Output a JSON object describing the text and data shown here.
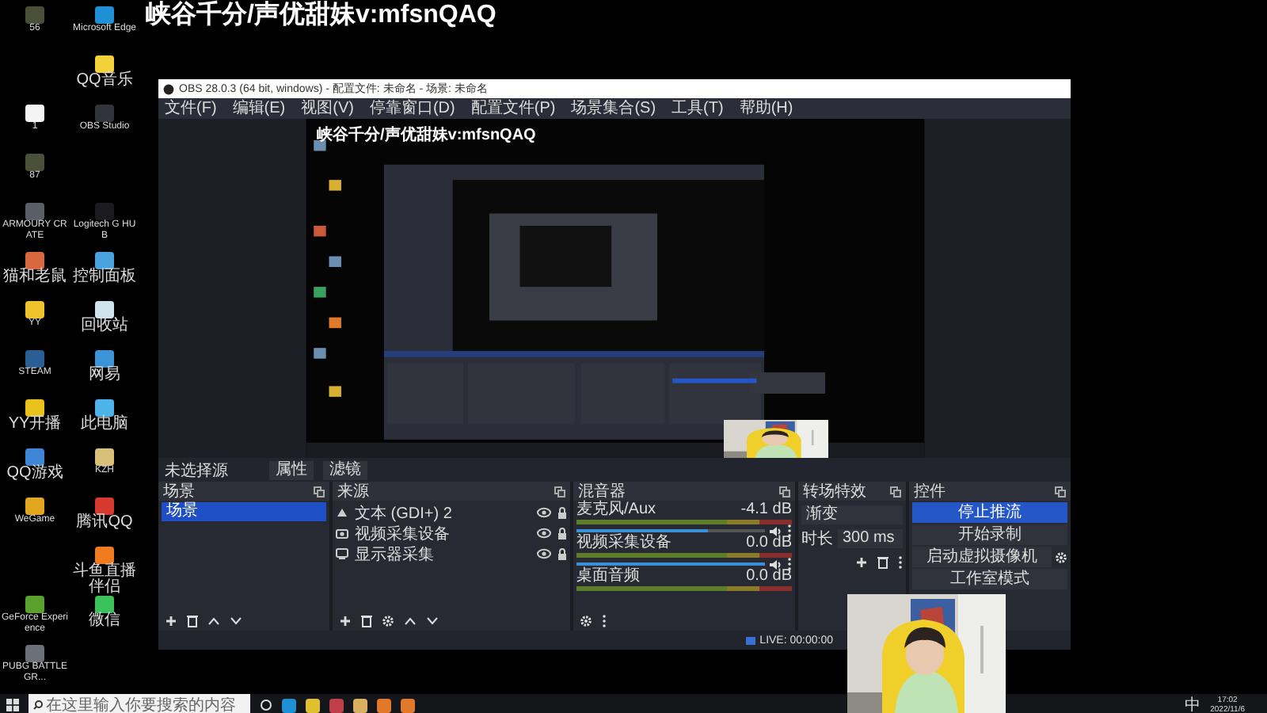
{
  "overlay_text": "峡谷千分/声优甜妹v:mfsnQAQ",
  "desktop_rows": [
    {
      "icons": [
        {
          "kind": "app",
          "label": "56",
          "color": "#4a4f3a"
        },
        {
          "kind": "app",
          "label": "Microsoft Edge",
          "color": "#1f8fd6"
        }
      ]
    },
    {
      "icons": [
        {
          "kind": "blank"
        },
        {
          "kind": "app",
          "label": "QQ音乐",
          "color": "#f2d13a"
        }
      ]
    },
    {
      "icons": [
        {
          "kind": "app",
          "label": "1",
          "color": "#f4f4f4"
        },
        {
          "kind": "app",
          "label": "OBS Studio",
          "color": "#30343a"
        }
      ]
    },
    {
      "icons": [
        {
          "kind": "app",
          "label": "87",
          "color": "#4a4f3a"
        },
        {
          "kind": "blank"
        }
      ]
    },
    {
      "icons": [
        {
          "kind": "app",
          "label": "ARMOURY CRATE",
          "color": "#5a5e66"
        },
        {
          "kind": "app",
          "label": "Logitech G HUB",
          "color": "#1b1b1f"
        }
      ]
    },
    {
      "icons": [
        {
          "kind": "app",
          "label": "猫和老鼠",
          "color": "#d9673f"
        },
        {
          "kind": "app",
          "label": "控制面板",
          "color": "#4aa3df"
        }
      ]
    },
    {
      "icons": [
        {
          "kind": "app",
          "label": "YY",
          "color": "#f0c22c"
        },
        {
          "kind": "app",
          "label": "回收站",
          "color": "#cfe3ef"
        }
      ]
    },
    {
      "icons": [
        {
          "kind": "app",
          "label": "STEAM",
          "color": "#2a5f95"
        },
        {
          "kind": "app",
          "label": "网易",
          "color": "#3c94d8"
        }
      ]
    },
    {
      "icons": [
        {
          "kind": "app",
          "label": "YY开播",
          "color": "#e9c21c"
        },
        {
          "kind": "app",
          "label": "此电脑",
          "color": "#4db3e8"
        }
      ]
    },
    {
      "icons": [
        {
          "kind": "app",
          "label": "QQ游戏",
          "color": "#3f86d6"
        },
        {
          "kind": "app",
          "label": "KZH",
          "color": "#d9c07a"
        }
      ]
    },
    {
      "icons": [
        {
          "kind": "app",
          "label": "WeGame",
          "color": "#e1a520"
        },
        {
          "kind": "app",
          "label": "腾讯QQ",
          "color": "#d63a2f"
        }
      ]
    },
    {
      "icons": [
        {
          "kind": "blank"
        },
        {
          "kind": "app",
          "label": "斗鱼直播伴侣",
          "color": "#f07a1e"
        }
      ]
    },
    {
      "icons": [
        {
          "kind": "app",
          "label": "GeForce Experience",
          "color": "#5aa02c"
        },
        {
          "kind": "app",
          "label": "微信",
          "color": "#3cc25a"
        }
      ]
    },
    {
      "icons": [
        {
          "kind": "app",
          "label": "PUBG BATTLEGR...",
          "color": "#6c7078"
        },
        {
          "kind": "blank"
        }
      ]
    }
  ],
  "obs": {
    "title": "OBS 28.0.3 (64 bit, windows) - 配置文件: 未命名 - 场景: 未命名",
    "menu": [
      "文件(F)",
      "编辑(E)",
      "视图(V)",
      "停靠窗口(D)",
      "配置文件(P)",
      "场景集合(S)",
      "工具(T)",
      "帮助(H)"
    ],
    "preview_text": "峡谷千分/声优甜妹v:mfsnQAQ",
    "source_bar": {
      "label": "未选择源",
      "buttons": [
        "属性",
        "滤镜"
      ]
    },
    "scenes": {
      "title": "场景",
      "items": [
        {
          "label": "场景",
          "selected": true
        }
      ]
    },
    "sources": {
      "title": "来源",
      "items": [
        {
          "kind": "text",
          "label": "文本 (GDI+) 2",
          "visible": true
        },
        {
          "kind": "camera",
          "label": "视频采集设备",
          "visible": true
        },
        {
          "kind": "display",
          "label": "显示器采集",
          "visible": true
        }
      ]
    },
    "mixer": {
      "title": "混音器",
      "channels": [
        {
          "name": "麦克风/Aux",
          "reading": "-4.1 dB",
          "level": 0.7
        },
        {
          "name": "视频采集设备",
          "reading": "0.0 dB",
          "level": 1.0
        },
        {
          "name": "桌面音频",
          "reading": "0.0 dB"
        }
      ]
    },
    "transitions": {
      "title": "转场特效",
      "selected": "渐变",
      "duration_label": "时长",
      "duration": "300 ms"
    },
    "controls": {
      "title": "控件",
      "buttons": [
        {
          "label": "停止推流",
          "primary": true
        },
        {
          "label": "开始录制",
          "primary": false
        },
        {
          "label": "启动虚拟摄像机",
          "primary": false
        },
        {
          "label": "工作室模式",
          "primary": false
        }
      ]
    },
    "status": "LIVE: 00:00:00"
  },
  "taskbar": {
    "search_placeholder": "在这里输入你要搜索的内容",
    "ime": "中",
    "time": "17:02",
    "date": "2022/11/6"
  }
}
